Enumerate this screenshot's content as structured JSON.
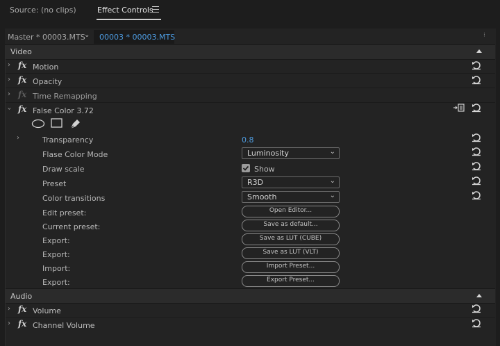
{
  "tabs": {
    "source": "Source: (no clips)",
    "effect_controls": "Effect Controls"
  },
  "source_bar": {
    "master": "Master * 00003.MTS",
    "clip": "00003 * 00003.MTS"
  },
  "sections": {
    "video": "Video",
    "audio": "Audio"
  },
  "fx_label": "fx",
  "effects": {
    "motion": "Motion",
    "opacity": "Opacity",
    "time_remapping": "Time Remapping",
    "false_color": "False Color 3.72",
    "volume": "Volume",
    "channel_volume": "Channel Volume"
  },
  "params": {
    "transparency": {
      "label": "Transparency",
      "value": "0.8"
    },
    "flase_color_mode": {
      "label": "Flase Color Mode",
      "value": "Luminosity"
    },
    "draw_scale": {
      "label": "Draw scale",
      "value": "Show",
      "checked": true
    },
    "preset": {
      "label": "Preset",
      "value": "R3D"
    },
    "color_transitions": {
      "label": "Color transitions",
      "value": "Smooth"
    },
    "edit_preset": {
      "label": "Edit preset:",
      "button": "Open Editor..."
    },
    "current_preset": {
      "label": "Current preset:",
      "button": "Save as default..."
    },
    "export_cube": {
      "label": "Export:",
      "button": "Save as LUT (CUBE)"
    },
    "export_vlt": {
      "label": "Export:",
      "button": "Save as LUT (VLT)"
    },
    "import": {
      "label": "Import:",
      "button": "Import Preset..."
    },
    "export_preset": {
      "label": "Export:",
      "button": "Export Preset..."
    }
  },
  "colors": {
    "accent_blue": "#4e9bde",
    "panel_bg": "#232323",
    "section_bg": "#2b2b2b"
  }
}
